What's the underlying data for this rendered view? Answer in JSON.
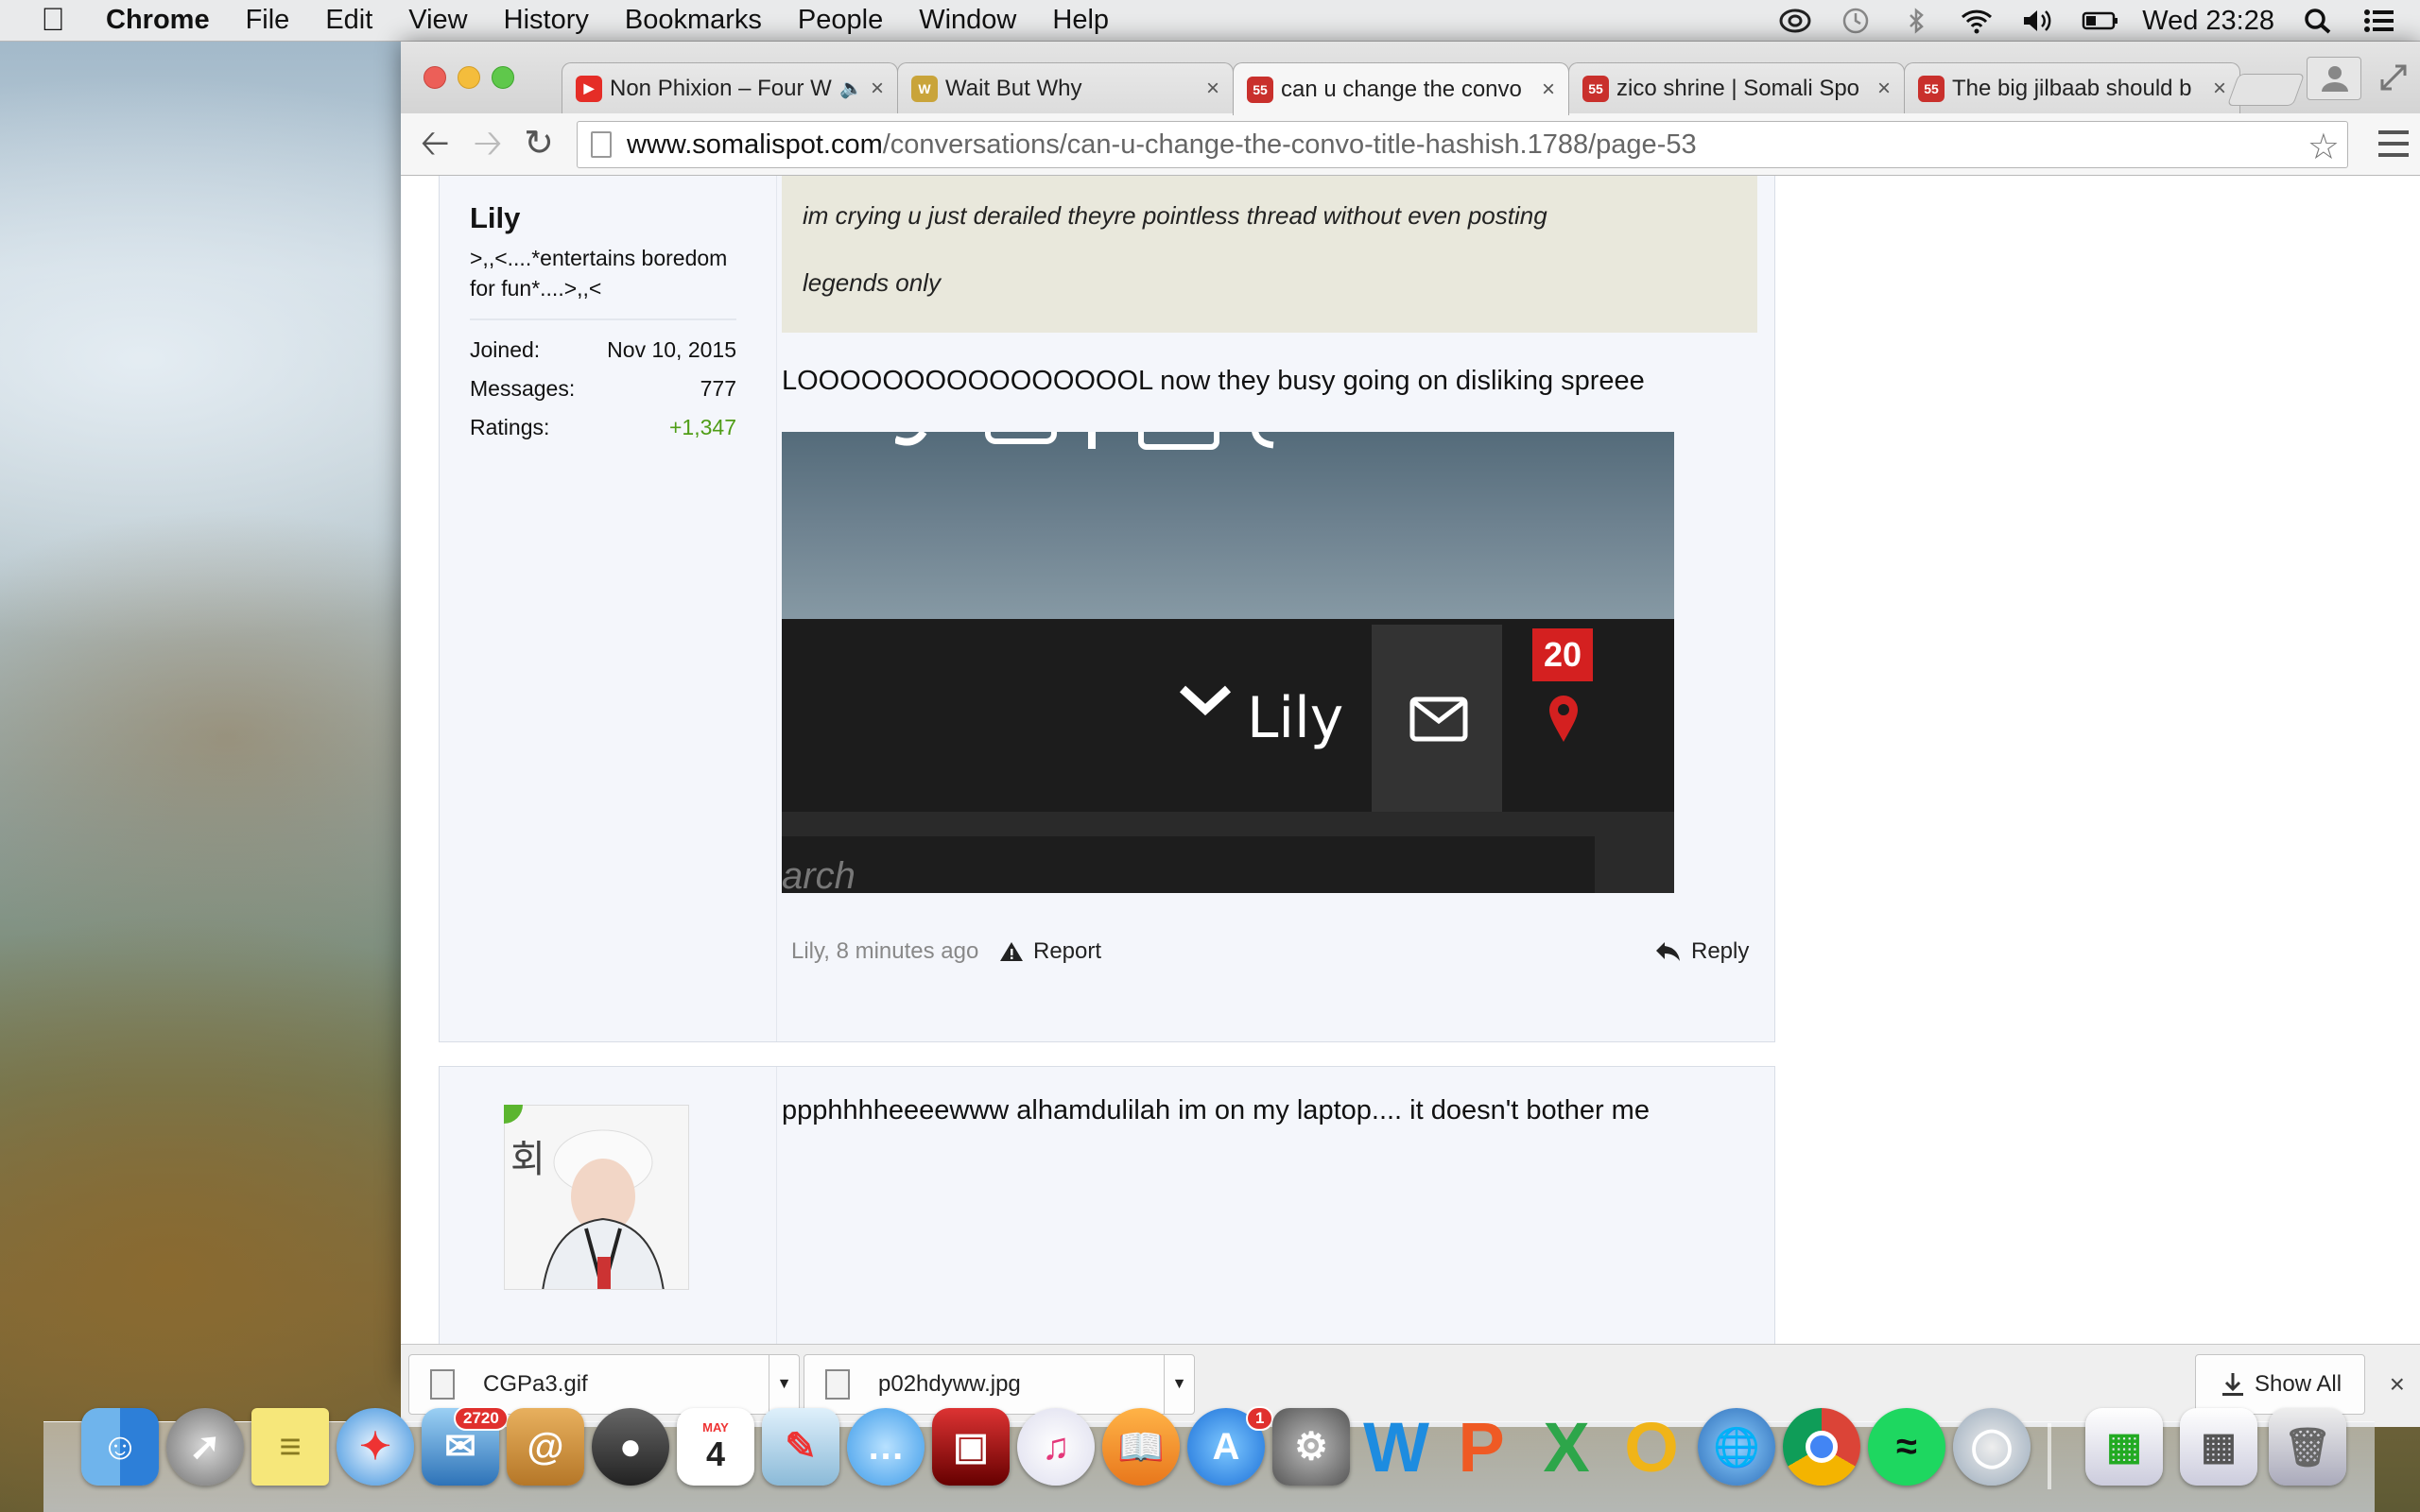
{
  "menubar": {
    "app": "Chrome",
    "items": [
      "File",
      "Edit",
      "View",
      "History",
      "Bookmarks",
      "People",
      "Window",
      "Help"
    ],
    "clock": "Wed 23:28"
  },
  "tabs": [
    {
      "label": "Non Phixion – Four W",
      "icon": "youtube-icon",
      "color": "#e52d27"
    },
    {
      "label": "Wait But Why",
      "icon": "waitbutwhy-icon",
      "color": "#c9a43a"
    },
    {
      "label": "can u change the convo",
      "icon": "somalispot-icon",
      "color": "#c9302c"
    },
    {
      "label": "zico shrine | Somali Spo",
      "icon": "somalispot-icon",
      "color": "#c9302c"
    },
    {
      "label": "The big jilbaab should b",
      "icon": "somalispot-icon",
      "color": "#c9302c"
    }
  ],
  "address": {
    "host": "www.somalispot.com",
    "path": "/conversations/can-u-change-the-convo-title-hashish.1788/page-53"
  },
  "post1": {
    "username": "Lily",
    "user_title": ">,,<....*entertains boredom for fun*....>,,<",
    "stats": [
      {
        "label": "Joined:",
        "value": "Nov 10, 2015"
      },
      {
        "label": "Messages:",
        "value": "777"
      },
      {
        "label": "Ratings:",
        "value": "+1,347"
      }
    ],
    "quote_lines": [
      "im crying u just derailed theyre pointless thread without even posting",
      "legends only"
    ],
    "message": "LOOOOOOOOOOOOOOOOL now they busy going on disliking spreee",
    "attachment": {
      "username": "Lily",
      "notif_count": "20",
      "search_fragment": "arch"
    },
    "meta": "Lily, 8 minutes ago",
    "report": "Report",
    "reply": "Reply"
  },
  "post2": {
    "message": "ppphhhheeeewww alhamdulilah im on my laptop.... it doesn't bother me"
  },
  "downloads": {
    "items": [
      "CGPa3.gif",
      "p02hdyww.jpg"
    ],
    "show_all": "Show All"
  },
  "dock": {
    "mail_badge": "2720",
    "calendar_month": "MAY",
    "calendar_day": "4",
    "appstore_badge": "1"
  }
}
